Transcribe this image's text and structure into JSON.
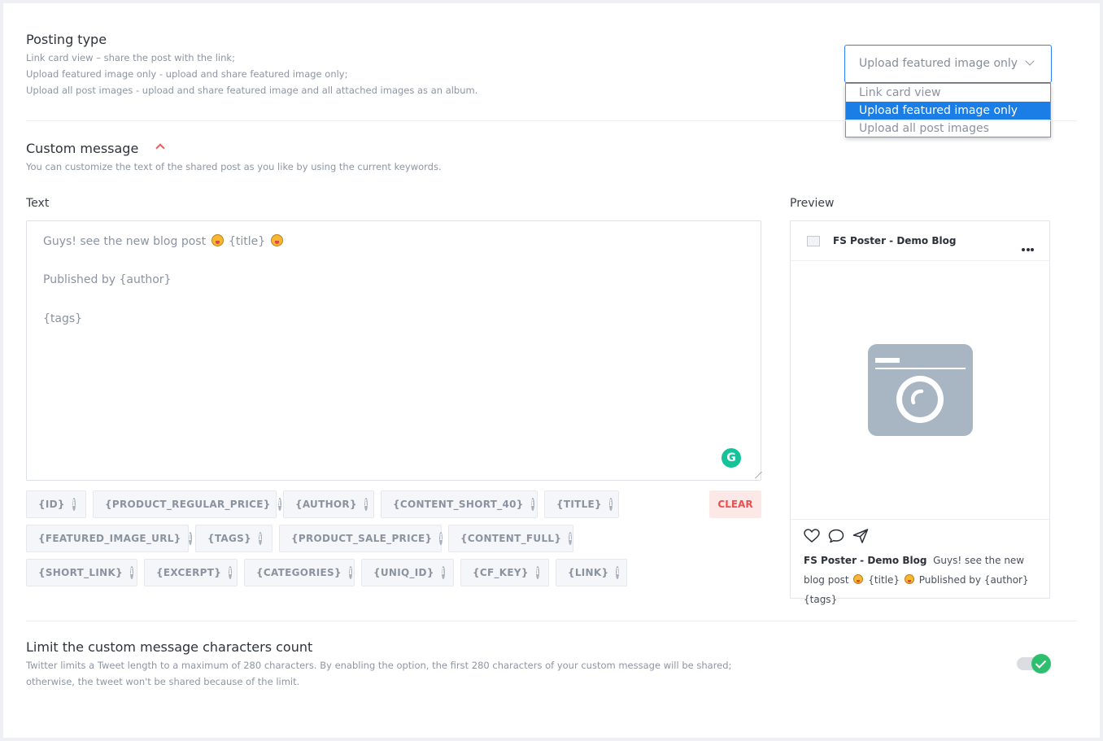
{
  "posting_type": {
    "title": "Posting type",
    "desc_lines": [
      "Link card view – share the post with the link;",
      "Upload featured image only - upload and share featured image only;",
      "Upload all post images - upload and share featured image and all attached images as an album."
    ],
    "select_value": "Upload featured image only",
    "options": [
      "Link card view",
      "Upload featured image only",
      "Upload all post images"
    ]
  },
  "custom_message": {
    "title": "Custom message",
    "desc": "You can customize the text of the shared post as you like by using the current keywords.",
    "text_label": "Text",
    "preview_label": "Preview",
    "text_lines": {
      "line1_a": "Guys! see the new blog post",
      "line1_b": "{title}",
      "line2": "Published by {author}",
      "line3": "{tags}"
    },
    "keywords": {
      "row1": [
        "{ID}",
        "{PRODUCT_REGULAR_PRICE}",
        "{AUTHOR}",
        "{CONTENT_SHORT_40}",
        "{TITLE}"
      ],
      "row2": [
        "{FEATURED_IMAGE_URL}",
        "{TAGS}",
        "{PRODUCT_SALE_PRICE}",
        "{CONTENT_FULL}"
      ],
      "row3": [
        "{SHORT_LINK}",
        "{EXCERPT}",
        "{CATEGORIES}",
        "{UNIQ_ID}",
        "{CF_KEY}",
        "{LINK}"
      ]
    },
    "info_glyph": "i",
    "clear_label": "CLEAR"
  },
  "preview": {
    "account_name": "FS Poster - Demo Blog",
    "caption_a": "Guys! see the new blog post",
    "caption_b": "{title}",
    "caption_c": "Published by {author} {tags}"
  },
  "limit": {
    "title": "Limit the custom message characters count",
    "desc_line1": "Twitter limits a Tweet length to a maximum of 280 characters. By enabling the option, the first 280 characters of your custom message will be shared;",
    "desc_line2": "otherwise, the tweet won't be shared because of the limit.",
    "enabled": true
  },
  "icons": {
    "grammarly": "grammarly-icon",
    "collapse": "chevron-up-icon",
    "heart": "heart-icon",
    "comment": "comment-icon",
    "share": "send-icon",
    "image_placeholder": "image-placeholder-icon"
  },
  "colors": {
    "accent": "#1a7ee6",
    "danger": "#ec4f4f",
    "success": "#2dbf6d",
    "grammarly": "#15c39a"
  }
}
